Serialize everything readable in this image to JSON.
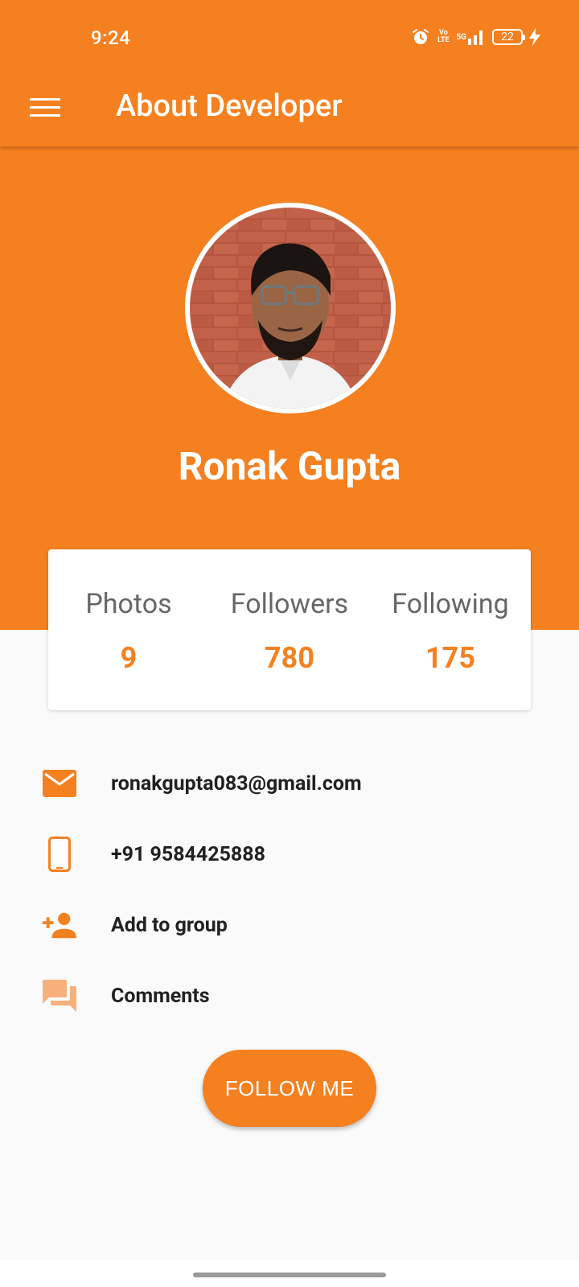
{
  "colors": {
    "accent": "#f58020",
    "background": "#fafafa",
    "text_dark": "#212121",
    "label_gray": "#666666"
  },
  "status_bar": {
    "time": "9:24",
    "battery": "22",
    "volte": "Vo LTE",
    "network": "5G"
  },
  "app_bar": {
    "title": "About Developer",
    "menu_icon": "hamburger-menu-icon"
  },
  "profile": {
    "name": "Ronak Gupta"
  },
  "stats": [
    {
      "label": "Photos",
      "value": "9"
    },
    {
      "label": "Followers",
      "value": "780"
    },
    {
      "label": "Following",
      "value": "175"
    }
  ],
  "contacts": [
    {
      "icon": "email-icon",
      "text": "ronakgupta083@gmail.com"
    },
    {
      "icon": "phone-icon",
      "text": "+91 9584425888"
    },
    {
      "icon": "add-person-icon",
      "text": "Add to group"
    },
    {
      "icon": "comments-icon",
      "text": "Comments"
    }
  ],
  "follow_button": {
    "label": "FOLLOW ME"
  }
}
